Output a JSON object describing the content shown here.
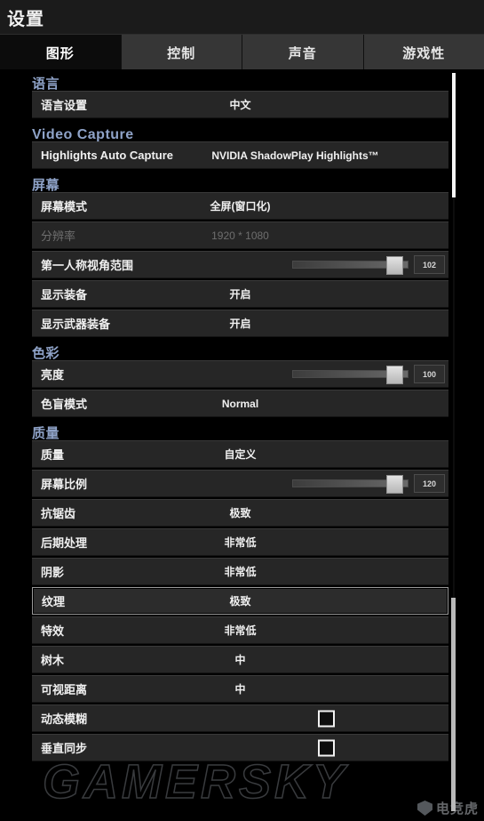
{
  "window": {
    "title": "设置"
  },
  "tabs": [
    {
      "label": "图形",
      "active": true
    },
    {
      "label": "控制",
      "active": false
    },
    {
      "label": "声音",
      "active": false
    },
    {
      "label": "游戏性",
      "active": false
    }
  ],
  "sections": [
    {
      "header": "语言",
      "latin": false,
      "rows": [
        {
          "label": "语言设置",
          "type": "value",
          "value": "中文"
        }
      ]
    },
    {
      "header": "Video Capture",
      "latin": true,
      "rows": [
        {
          "label": "Highlights Auto Capture",
          "type": "value",
          "value": "NVIDIA ShadowPlay Highlights™",
          "latin": true
        }
      ]
    },
    {
      "header": "屏幕",
      "latin": false,
      "rows": [
        {
          "label": "屏幕模式",
          "type": "value",
          "value": "全屏(窗口化)"
        },
        {
          "label": "分辨率",
          "type": "value",
          "value": "1920 * 1080",
          "disabled": true
        },
        {
          "label": "第一人称视角范围",
          "type": "slider",
          "value": "102",
          "fill": 88
        },
        {
          "label": "显示装备",
          "type": "value",
          "value": "开启"
        },
        {
          "label": "显示武器装备",
          "type": "value",
          "value": "开启"
        }
      ]
    },
    {
      "header": "色彩",
      "latin": false,
      "rows": [
        {
          "label": "亮度",
          "type": "slider",
          "value": "100",
          "fill": 88
        },
        {
          "label": "色盲模式",
          "type": "value",
          "value": "Normal"
        }
      ]
    },
    {
      "header": "质量",
      "latin": false,
      "rows": [
        {
          "label": "质量",
          "type": "value",
          "value": "自定义"
        },
        {
          "label": "屏幕比例",
          "type": "slider",
          "value": "120",
          "fill": 88
        },
        {
          "label": "抗锯齿",
          "type": "value",
          "value": "极致"
        },
        {
          "label": "后期处理",
          "type": "value",
          "value": "非常低"
        },
        {
          "label": "阴影",
          "type": "value",
          "value": "非常低"
        },
        {
          "label": "纹理",
          "type": "value",
          "value": "极致",
          "selected": true
        },
        {
          "label": "特效",
          "type": "value",
          "value": "非常低"
        },
        {
          "label": "树木",
          "type": "value",
          "value": "中"
        },
        {
          "label": "可视距离",
          "type": "value",
          "value": "中"
        },
        {
          "label": "动态模糊",
          "type": "checkbox",
          "checked": false
        },
        {
          "label": "垂直同步",
          "type": "checkbox",
          "checked": false
        }
      ]
    }
  ],
  "scrollbars": {
    "outer_position": "top",
    "inner_position": "bottom"
  },
  "watermark": {
    "text": "GAMERSKY",
    "brand": "电竞虎"
  },
  "colors": {
    "section_header": "#8fa3c8",
    "row_background": "#262626",
    "selected_border": "#9a9a9a",
    "page_background": "#000000",
    "tab_inactive": "#363636",
    "tab_active": "#0c0c0c"
  }
}
